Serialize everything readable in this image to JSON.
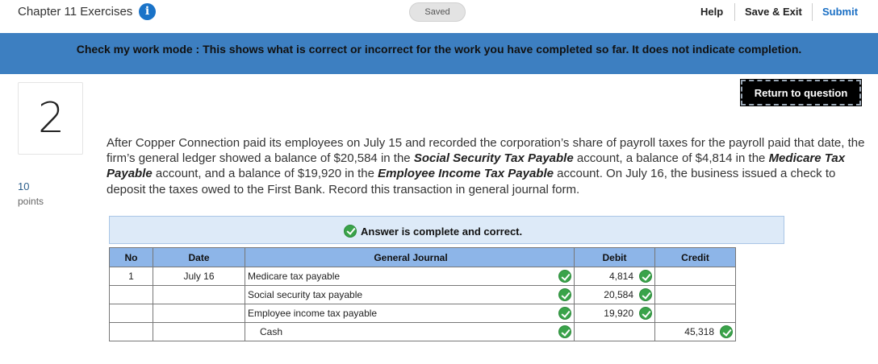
{
  "header": {
    "chapter_title": "Chapter 11 Exercises",
    "info_icon": "info-icon",
    "saved_label": "Saved",
    "help_label": "Help",
    "save_exit_label": "Save & Exit",
    "submit_label": "Submit"
  },
  "banner": {
    "text": "Check my work mode : This shows what is correct or incorrect for the work you have completed so far. It does not indicate completion."
  },
  "question": {
    "number": "2",
    "points_value": "10",
    "points_label": "points",
    "return_label": "Return to question",
    "text_parts": [
      "After Copper Connection paid its employees on July 15 and recorded the corporation’s share of payroll taxes for the payroll paid that date, the firm’s general ledger showed a balance of $20,584 in the ",
      "Social Security Tax Payable",
      " account, a balance of $4,814 in the ",
      "Medicare Tax Payable",
      " account, and a balance of $19,920 in the ",
      "Employee Income Tax Payable",
      " account. On July 16, the business issued a check to deposit the taxes owed to the First Bank. Record this transaction in general journal form."
    ]
  },
  "answer": {
    "status_text": "Answer is complete and correct.",
    "status_icon": "check-circle-icon",
    "columns": [
      "No",
      "Date",
      "General Journal",
      "Debit",
      "Credit"
    ],
    "rows": [
      {
        "no": "1",
        "date": "July 16",
        "account": "Medicare tax payable",
        "debit": "4,814",
        "credit": ""
      },
      {
        "no": "",
        "date": "",
        "account": "Social security tax payable",
        "debit": "20,584",
        "credit": ""
      },
      {
        "no": "",
        "date": "",
        "account": "Employee income tax payable",
        "debit": "19,920",
        "credit": ""
      },
      {
        "no": "",
        "date": "",
        "account": "Cash",
        "debit": "",
        "credit": "45,318"
      }
    ]
  },
  "colors": {
    "banner": "#3d7fc1",
    "header_row": "#8db5e8",
    "check_green": "#3aa34a",
    "submit_blue": "#1a6fc4"
  }
}
